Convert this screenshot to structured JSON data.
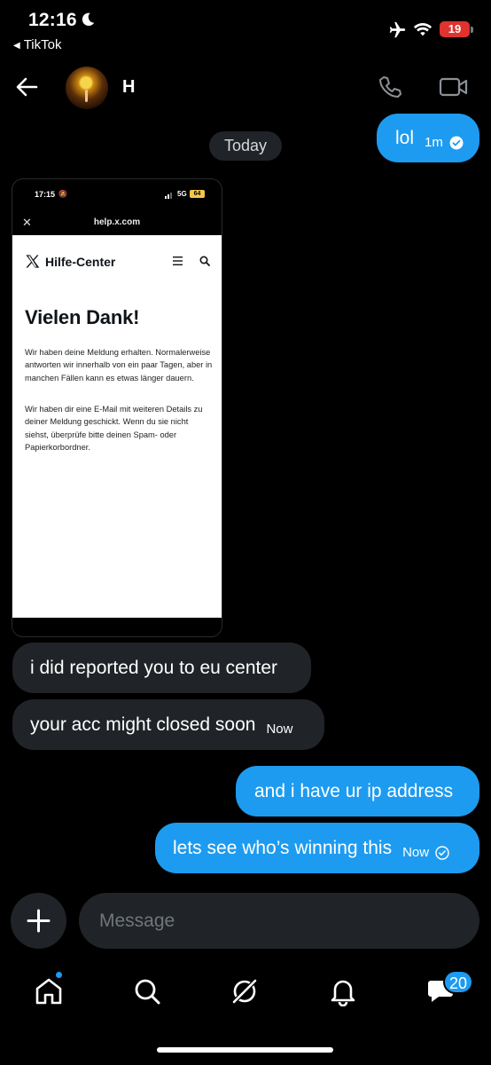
{
  "status_bar": {
    "time": "12:16",
    "back_app": "TikTok",
    "battery": "19"
  },
  "header": {
    "contact_name": "H"
  },
  "conversation": {
    "date_separator": "Today",
    "messages": [
      {
        "direction": "out",
        "text": "lol",
        "time": "1m",
        "status": "read"
      },
      {
        "direction": "in",
        "type": "image",
        "text": ""
      },
      {
        "direction": "in",
        "text": "i did reported you to eu center",
        "time": ""
      },
      {
        "direction": "in",
        "text": "your acc might closed soon",
        "time": "Now"
      },
      {
        "direction": "out",
        "text": "and i have ur ip address",
        "time": ""
      },
      {
        "direction": "out",
        "text": "lets see who’s winning this",
        "time": "Now",
        "status": "sent"
      }
    ]
  },
  "attachment": {
    "status_time": "17:15",
    "network": "5G",
    "battery": "64",
    "url": "help.x.com",
    "site_title": "Hilfe-Center",
    "heading": "Vielen Dank!",
    "paragraph_1": "Wir haben deine Meldung erhalten. Normalerweise antworten wir innerhalb von ein paar Tagen, aber in manchen Fällen kann es etwas länger dauern.",
    "paragraph_2": "Wir haben dir eine E-Mail mit weiteren Details zu deiner Meldung geschickt. Wenn du sie nicht siehst, überprüfe bitte deinen Spam- oder Papierkorbordner."
  },
  "composer": {
    "placeholder": "Message"
  },
  "bottom_nav": {
    "items": [
      "home-icon",
      "search-icon",
      "grok-icon",
      "notifications-icon",
      "messages-icon"
    ],
    "messages_badge": "20"
  },
  "colors": {
    "accent": "#1d9bf0",
    "incoming_bubble": "#202327",
    "background": "#000000"
  }
}
